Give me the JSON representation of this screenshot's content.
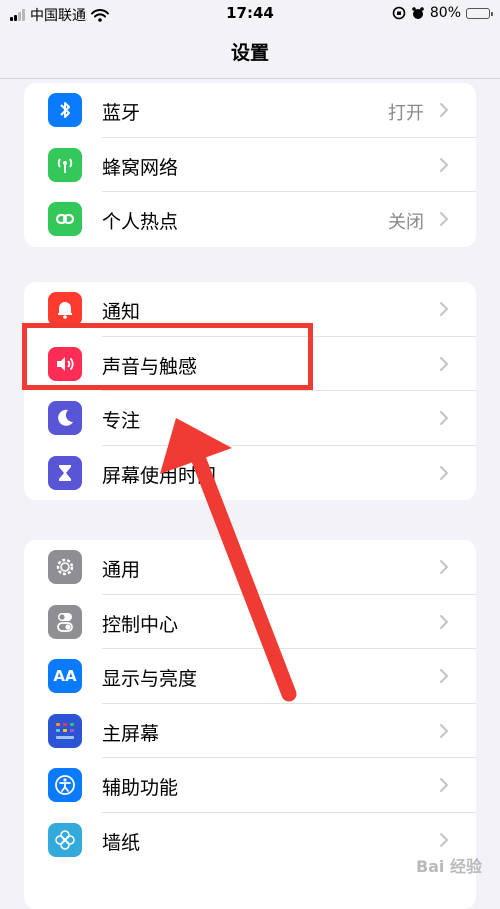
{
  "status_bar": {
    "carrier": "中国联通",
    "time": "17:44",
    "battery_percent": "80%",
    "battery_level": 0.8
  },
  "nav": {
    "title": "设置"
  },
  "groups": [
    {
      "items": [
        {
          "label": "蓝牙",
          "value": "打开",
          "icon": "bluetooth-icon",
          "color": "#0a7aff"
        },
        {
          "label": "蜂窝网络",
          "value": "",
          "icon": "antenna-icon",
          "color": "#34c759"
        },
        {
          "label": "个人热点",
          "value": "关闭",
          "icon": "hotspot-link-icon",
          "color": "#34c759"
        }
      ]
    },
    {
      "items": [
        {
          "label": "通知",
          "value": "",
          "icon": "bell-icon",
          "color": "#ff3b30"
        },
        {
          "label": "声音与触感",
          "value": "",
          "icon": "speaker-icon",
          "color": "#ff2d55"
        },
        {
          "label": "专注",
          "value": "",
          "icon": "moon-icon",
          "color": "#5856d6"
        },
        {
          "label": "屏幕使用时间",
          "value": "",
          "icon": "hourglass-icon",
          "color": "#5856d6"
        }
      ]
    },
    {
      "items": [
        {
          "label": "通用",
          "value": "",
          "icon": "gear-icon",
          "color": "#8e8e93"
        },
        {
          "label": "控制中心",
          "value": "",
          "icon": "toggles-icon",
          "color": "#8e8e93"
        },
        {
          "label": "显示与亮度",
          "value": "",
          "icon": "text-size-icon",
          "color": "#0a7aff",
          "icon_text": "AA"
        },
        {
          "label": "主屏幕",
          "value": "",
          "icon": "home-grid-icon",
          "color": "#2c55d6"
        },
        {
          "label": "辅助功能",
          "value": "",
          "icon": "accessibility-icon",
          "color": "#0a7aff"
        },
        {
          "label": "墙纸",
          "value": "",
          "icon": "flower-icon",
          "color": "#34aadc"
        }
      ]
    }
  ],
  "watermark": {
    "text": "Bai 经验"
  },
  "annotation": {
    "color": "#ef3b34"
  }
}
